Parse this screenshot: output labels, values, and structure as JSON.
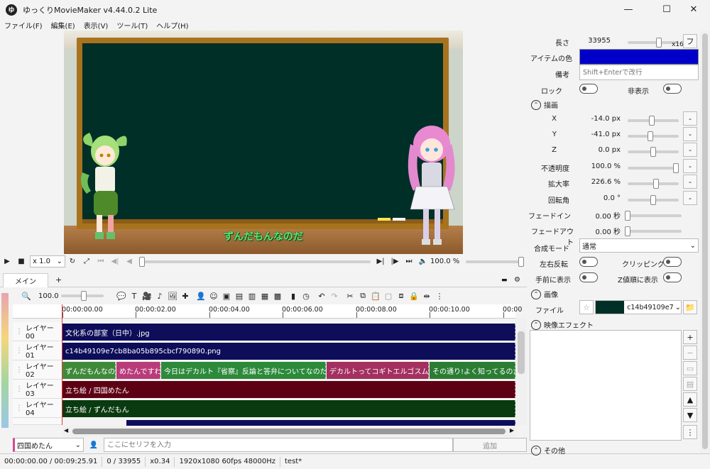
{
  "window": {
    "title": "ゆっくりMovieMaker v4.44.0.2 Lite",
    "icon_text": "ゆ",
    "minimize": "—",
    "maximize": "☐",
    "close": "✕"
  },
  "menu": [
    "ファイル(F)",
    "編集(E)",
    "表示(V)",
    "ツール(T)",
    "ヘルプ(H)"
  ],
  "preview": {
    "subtitle": "ずんだもんなのだ"
  },
  "transport": {
    "speed": "x 1.0",
    "volume": "100.0 %"
  },
  "timeline": {
    "tab": "メイン",
    "add_tab": "+",
    "zoom": "100.0",
    "ruler_labels": [
      "00:00:00.00",
      "00:00:02.00",
      "00:00:04.00",
      "00:00:06.00",
      "00:00:08.00",
      "00:00:10.00",
      "00:00"
    ],
    "layers": [
      {
        "name": "レイヤー 00",
        "clips": [
          {
            "text": "文化系の部室（日中）.jpg"
          }
        ]
      },
      {
        "name": "レイヤー 01",
        "clips": [
          {
            "text": "c14b49109e7cb8ba05b895cbcf790890.png"
          }
        ]
      },
      {
        "name": "レイヤー 02",
        "clips": [
          {
            "text": "ずんだもんなのだ"
          },
          {
            "text": "めたんですわ"
          },
          {
            "text": "今日はデカルト『省察』反論と答弁についてなのだ"
          },
          {
            "text": "デカルトってコギトエルゴスムの人で"
          },
          {
            "text": "その通り!よく知ってるのだ。そうい"
          }
        ]
      },
      {
        "name": "レイヤー 03",
        "clips": [
          {
            "text": "立ち絵 / 四国めたん"
          }
        ]
      },
      {
        "name": "レイヤー 04",
        "clips": [
          {
            "text": "立ち絵 / ずんだもん"
          }
        ]
      }
    ]
  },
  "talk": {
    "speaker": "四国めたん",
    "placeholder": "ここにセリフを入力",
    "add_button": "追加"
  },
  "status": {
    "time": "00:00:00.00  /  00:09:25.91",
    "frame": "0  /  33955",
    "zoom": "x0.34",
    "format": "1920x1080 60fps 48000Hz",
    "project": "test*"
  },
  "props": {
    "length_label": "長さ",
    "length_value": "33955",
    "length_unit": "x16",
    "length_btn": "フ",
    "item_color_label": "アイテムの色",
    "item_color": "#0000c8",
    "note_label": "備考",
    "note_placeholder": "Shift+Enterで改行",
    "lock_label": "ロック",
    "hide_label": "非表示",
    "draw_section": "描画",
    "x_label": "X",
    "x_value": "-14.0 px",
    "y_label": "Y",
    "y_value": "-41.0 px",
    "z_label": "Z",
    "z_value": "0.0 px",
    "opacity_label": "不透明度",
    "opacity_value": "100.0 %",
    "scale_label": "拡大率",
    "scale_value": "226.6 %",
    "rotate_label": "回転角",
    "rotate_value": "0.0 °",
    "fadein_label": "フェードイン",
    "fadein_value": "0.00 秒",
    "fadeout_label": "フェードアウト",
    "fadeout_value": "0.00 秒",
    "blend_label": "合成モード",
    "blend_value": "通常",
    "flip_label": "左右反転",
    "clip_label": "クリッピング",
    "front_label": "手前に表示",
    "zorder_label": "Z値順に表示",
    "image_section": "画像",
    "file_label": "ファイル",
    "file_value": "c14b49109e7",
    "effects_section": "映像エフェクト",
    "other_section": "その他",
    "minus": "-"
  }
}
